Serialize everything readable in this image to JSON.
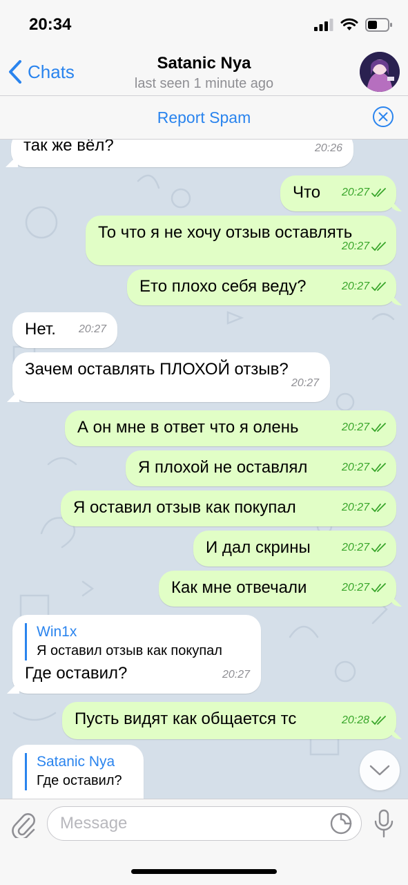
{
  "status_bar": {
    "time": "20:34"
  },
  "header": {
    "back_label": "Chats",
    "title": "Satanic Nya",
    "subtitle": "last seen 1 minute ago"
  },
  "report_bar": {
    "label": "Report Spam"
  },
  "messages": [
    {
      "dir": "in",
      "text": "так же вёл?",
      "time": "20:26"
    },
    {
      "dir": "out",
      "text": "Что",
      "time": "20:27"
    },
    {
      "dir": "out",
      "text": "То что я не хочу отзыв оставлять",
      "time": "20:27"
    },
    {
      "dir": "out",
      "text": "Ето плохо себя веду?",
      "time": "20:27"
    },
    {
      "dir": "in",
      "text": "Нет.",
      "time": "20:27"
    },
    {
      "dir": "in",
      "text": "Зачем оставлять ПЛОХОЙ отзыв?",
      "time": "20:27"
    },
    {
      "dir": "out",
      "text": "А он мне в ответ что я олень",
      "time": "20:27"
    },
    {
      "dir": "out",
      "text": "Я плохой не оставлял",
      "time": "20:27"
    },
    {
      "dir": "out",
      "text": "Я оставил отзыв как покупал",
      "time": "20:27"
    },
    {
      "dir": "out",
      "text": "И дал скрины",
      "time": "20:27"
    },
    {
      "dir": "out",
      "text": "Как мне отвечали",
      "time": "20:27"
    },
    {
      "dir": "in",
      "reply_author": "Win1x",
      "reply_text": "Я оставил отзыв как покупал",
      "text": "Где оставил?",
      "time": "20:27"
    },
    {
      "dir": "out",
      "text": "Пусть видят как общается тс",
      "time": "20:28"
    },
    {
      "dir": "in",
      "reply_author": "Satanic Nya",
      "reply_text": "Где оставил?"
    }
  ],
  "composer": {
    "placeholder": "Message"
  },
  "colors": {
    "accent": "#2a84ee",
    "outgoing_bubble": "#e1fec6",
    "incoming_bubble": "#ffffff",
    "read_ticks": "#38a52a"
  },
  "icons": [
    "back-chevron-icon",
    "close-circle-icon",
    "read-ticks-icon",
    "chevron-down-icon",
    "paperclip-icon",
    "sticker-icon",
    "microphone-icon",
    "signal-icon",
    "wifi-icon",
    "battery-icon"
  ]
}
